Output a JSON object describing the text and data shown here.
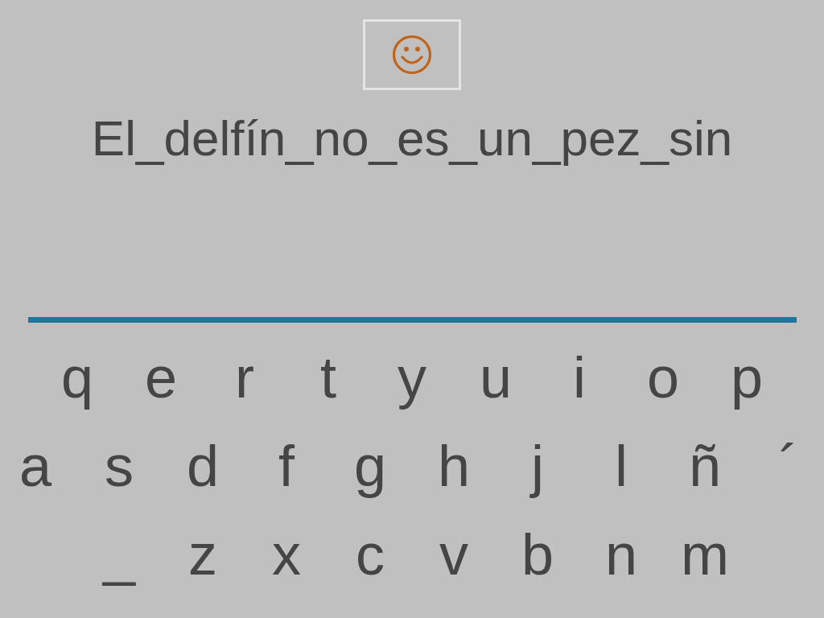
{
  "sentence": "El_delfín_no_es_un_pez_sin",
  "keyboard": {
    "rows": [
      [
        "q",
        "e",
        "r",
        "t",
        "y",
        "u",
        "i",
        "o",
        "p"
      ],
      [
        "a",
        "s",
        "d",
        "f",
        "g",
        "h",
        "j",
        "l",
        "ñ",
        "´"
      ],
      [
        "_",
        "z",
        "x",
        "c",
        "v",
        "b",
        "n",
        "m"
      ]
    ]
  }
}
